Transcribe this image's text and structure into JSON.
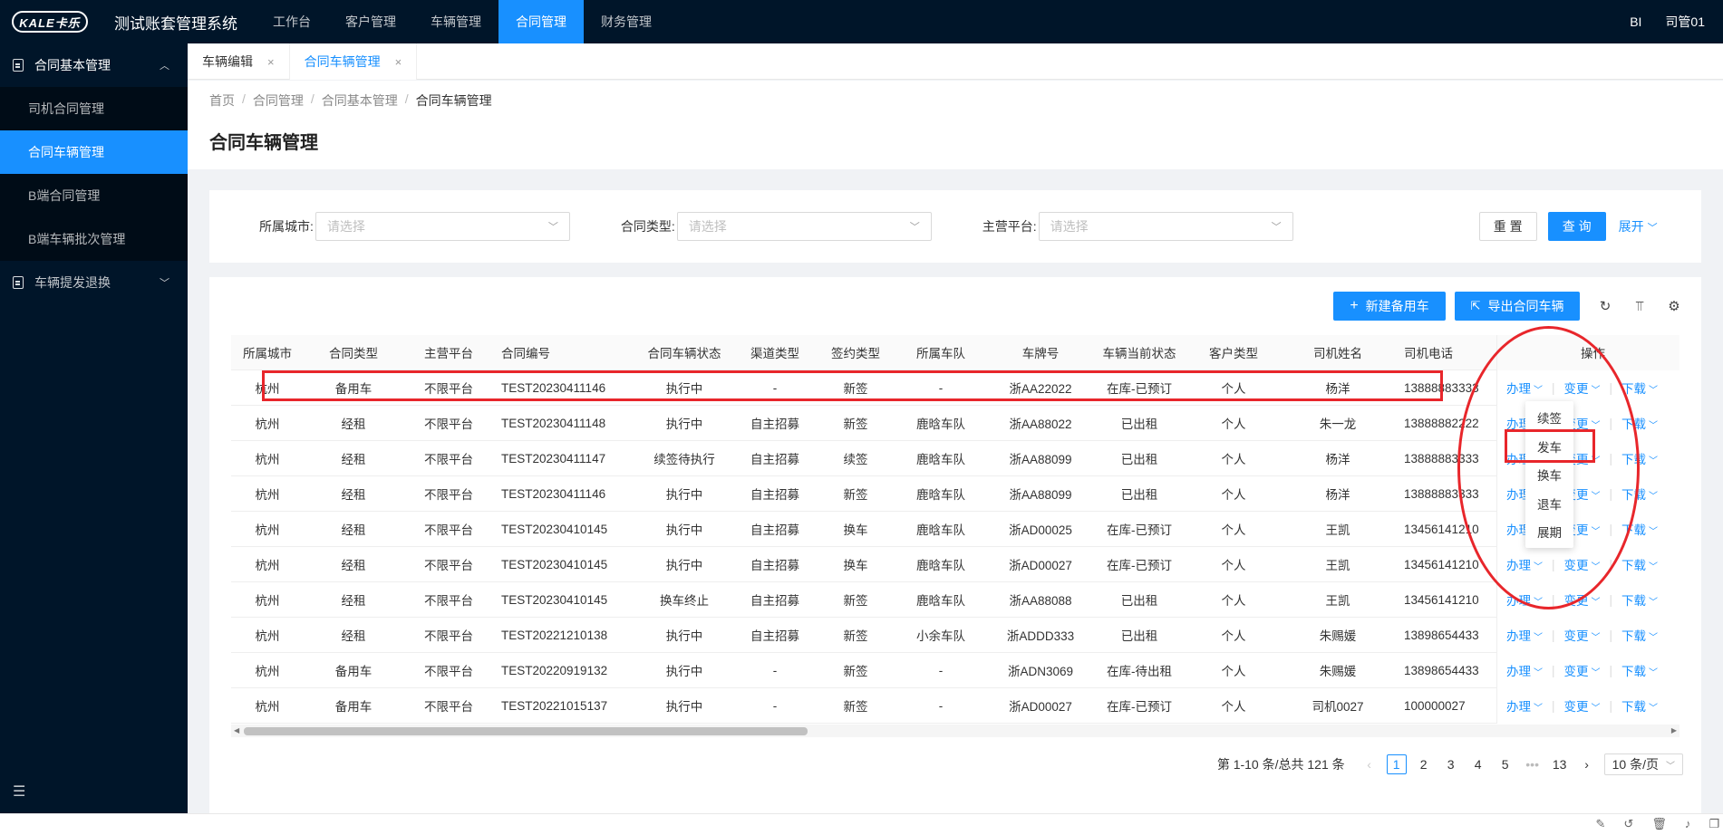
{
  "topbar": {
    "logo_text": "KALE卡乐",
    "app_title": "测试账套管理系统",
    "nav": [
      "工作台",
      "客户管理",
      "车辆管理",
      "合同管理",
      "财务管理"
    ],
    "active_nav": 3,
    "right_bi": "BI",
    "right_user": "司管01"
  },
  "sidebar": {
    "group1_label": "合同基本管理",
    "items": [
      "司机合同管理",
      "合同车辆管理",
      "B端合同管理",
      "B端车辆批次管理"
    ],
    "active_item": 1,
    "group2_label": "车辆提发退换"
  },
  "tabs": [
    {
      "label": "车辆编辑",
      "close": "×"
    },
    {
      "label": "合同车辆管理",
      "close": "×"
    }
  ],
  "breadcrumb": [
    "首页",
    "合同管理",
    "合同基本管理",
    "合同车辆管理"
  ],
  "page_title": "合同车辆管理",
  "filter": {
    "city_label": "所属城市:",
    "type_label": "合同类型:",
    "platform_label": "主营平台:",
    "placeholder": "请选择",
    "reset": "重 置",
    "query": "查 询",
    "expand": "展开"
  },
  "toolbar": {
    "new_spare": "新建备用车",
    "export": "导出合同车辆"
  },
  "table": {
    "headers": [
      "所属城市",
      "合同类型",
      "主营平台",
      "合同编号",
      "合同车辆状态",
      "渠道类型",
      "签约类型",
      "所属车队",
      "车牌号",
      "车辆当前状态",
      "客户类型",
      "司机姓名",
      "司机电话",
      "操作"
    ],
    "rows": [
      [
        "杭州",
        "备用车",
        "不限平台",
        "TEST20230411146",
        "执行中",
        "-",
        "新签",
        "-",
        "浙AA22022",
        "在库-已预订",
        "个人",
        "杨洋",
        "13888883333"
      ],
      [
        "杭州",
        "经租",
        "不限平台",
        "TEST20230411148",
        "执行中",
        "自主招募",
        "新签",
        "鹿晗车队",
        "浙AA88022",
        "已出租",
        "个人",
        "朱一龙",
        "13888882222"
      ],
      [
        "杭州",
        "经租",
        "不限平台",
        "TEST20230411147",
        "续签待执行",
        "自主招募",
        "续签",
        "鹿晗车队",
        "浙AA88099",
        "已出租",
        "个人",
        "杨洋",
        "13888883333"
      ],
      [
        "杭州",
        "经租",
        "不限平台",
        "TEST20230411146",
        "执行中",
        "自主招募",
        "新签",
        "鹿晗车队",
        "浙AA88099",
        "已出租",
        "个人",
        "杨洋",
        "13888883333"
      ],
      [
        "杭州",
        "经租",
        "不限平台",
        "TEST20230410145",
        "执行中",
        "自主招募",
        "换车",
        "鹿晗车队",
        "浙AD00025",
        "在库-已预订",
        "个人",
        "王凯",
        "13456141210"
      ],
      [
        "杭州",
        "经租",
        "不限平台",
        "TEST20230410145",
        "执行中",
        "自主招募",
        "换车",
        "鹿晗车队",
        "浙AD00027",
        "在库-已预订",
        "个人",
        "王凯",
        "13456141210"
      ],
      [
        "杭州",
        "经租",
        "不限平台",
        "TEST20230410145",
        "换车终止",
        "自主招募",
        "新签",
        "鹿晗车队",
        "浙AA88088",
        "已出租",
        "个人",
        "王凯",
        "13456141210"
      ],
      [
        "杭州",
        "经租",
        "不限平台",
        "TEST20221210138",
        "执行中",
        "自主招募",
        "新签",
        "小余车队",
        "浙ADDD333",
        "已出租",
        "个人",
        "朱赐媛",
        "13898654433"
      ],
      [
        "杭州",
        "备用车",
        "不限平台",
        "TEST20220919132",
        "执行中",
        "-",
        "新签",
        "-",
        "浙ADN3069",
        "在库-待出租",
        "个人",
        "朱赐媛",
        "13898654433"
      ],
      [
        "杭州",
        "备用车",
        "不限平台",
        "TEST20221015137",
        "执行中",
        "-",
        "新签",
        "-",
        "浙AD00027",
        "在库-已预订",
        "个人",
        "司机0027",
        "100000027"
      ]
    ],
    "ops": [
      "办理",
      "变更",
      "下载"
    ]
  },
  "dropdown": [
    "续签",
    "发车",
    "换车",
    "退车",
    "展期"
  ],
  "pagination": {
    "summary": "第 1-10 条/总共 121 条",
    "pages": [
      "1",
      "2",
      "3",
      "4",
      "5",
      "•••",
      "13"
    ],
    "active_page": "1",
    "page_size": "10 条/页"
  },
  "colors": {
    "nav_bg": "#001529",
    "primary": "#1890ff",
    "annotation": "#e8262b"
  }
}
